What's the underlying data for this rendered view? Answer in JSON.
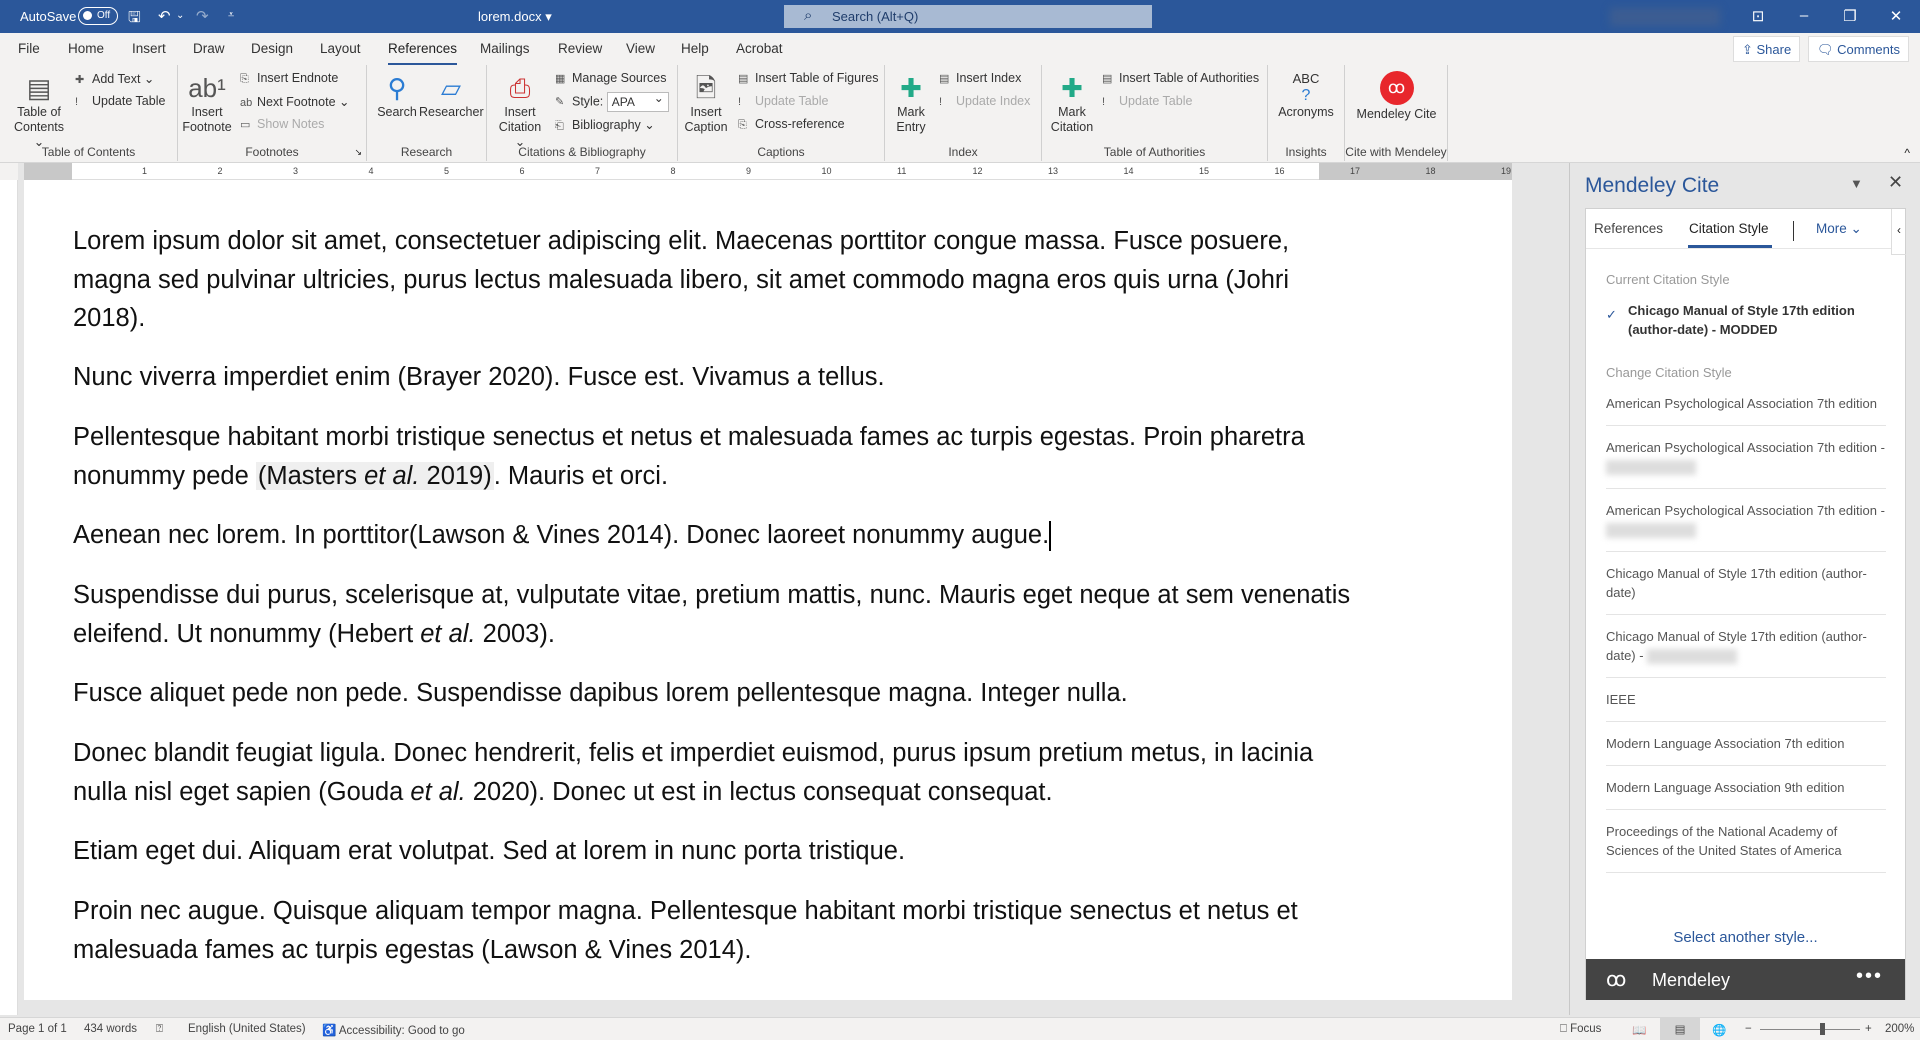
{
  "titlebar": {
    "autosave_label": "AutoSave",
    "autosave_state": "Off",
    "doc_name": "lorem.docx ▾",
    "search_placeholder": "Search (Alt+Q)",
    "icons": [
      "save-icon",
      "undo-icon",
      "redo-icon",
      "customize-icon"
    ]
  },
  "tabs": [
    "File",
    "Home",
    "Insert",
    "Draw",
    "Design",
    "Layout",
    "References",
    "Mailings",
    "Review",
    "View",
    "Help",
    "Acrobat"
  ],
  "active_tab": "References",
  "share_label": "Share",
  "comments_label": "Comments",
  "ribbon": {
    "toc": {
      "label": "Table of Contents",
      "big": "Table of Contents ⌄",
      "add_text": "Add Text ⌄",
      "update_table": "Update Table"
    },
    "footnotes": {
      "label": "Footnotes",
      "big": "Insert Footnote",
      "insert_endnote": "Insert Endnote",
      "next_footnote": "Next Footnote ⌄",
      "show_notes": "Show Notes"
    },
    "research": {
      "label": "Research",
      "search": "Search",
      "researcher": "Researcher"
    },
    "citations": {
      "label": "Citations & Bibliography",
      "big": "Insert Citation ⌄",
      "manage_sources": "Manage Sources",
      "style_label": "Style:",
      "style_value": "APA",
      "bibliography": "Bibliography ⌄"
    },
    "captions": {
      "label": "Captions",
      "big": "Insert Caption",
      "insert_tof": "Insert Table of Figures",
      "update_table": "Update Table",
      "cross_reference": "Cross-reference"
    },
    "index": {
      "label": "Index",
      "big": "Mark Entry",
      "insert_index": "Insert Index",
      "update_index": "Update Index"
    },
    "toa": {
      "label": "Table of Authorities",
      "big": "Mark Citation",
      "insert_toa": "Insert Table of Authorities",
      "update_table": "Update Table"
    },
    "insights": {
      "label": "Insights",
      "big": "Acronyms",
      "icon_text": "ABC"
    },
    "mendeley": {
      "label": "Cite with Mendeley",
      "big": "Mendeley Cite"
    }
  },
  "ruler_numbers": [
    "1",
    "2",
    "3",
    "4",
    "5",
    "6",
    "7",
    "8",
    "9",
    "10",
    "11",
    "12",
    "13",
    "14",
    "15",
    "16",
    "17",
    "18",
    "19"
  ],
  "document": {
    "paragraphs": [
      [
        "Lorem ipsum dolor sit amet, consectetuer adipiscing elit. Maecenas porttitor congue massa. Fusce posuere, magna sed pulvinar ultricies, purus lectus malesuada libero, sit amet commodo magna eros quis urna (Johri 2018)."
      ],
      [
        "Nunc viverra imperdiet enim (Brayer 2020). Fusce est. Vivamus a tellus."
      ],
      [
        "Pellentesque habitant morbi tristique senectus et netus et malesuada fames ac turpis egestas. Proin pharetra nonummy pede ",
        "(Masters ",
        "et al.",
        " 2019)",
        ". Mauris et orci."
      ],
      [
        "Aenean nec lorem. In porttitor(Lawson & Vines 2014). Donec laoreet nonummy augue."
      ],
      [
        "Suspendisse dui purus, scelerisque at, vulputate vitae, pretium mattis, nunc. Mauris eget neque at sem venenatis eleifend. Ut nonummy (Hebert ",
        "et al.",
        " 2003)."
      ],
      [
        "Fusce aliquet pede non pede. Suspendisse dapibus lorem pellentesque magna. Integer nulla."
      ],
      [
        "Donec blandit feugiat ligula. Donec hendrerit, felis et imperdiet euismod, purus ipsum pretium metus, in lacinia nulla nisl eget sapien (Gouda ",
        "et al.",
        " 2020). Donec ut est in lectus consequat consequat."
      ],
      [
        "Etiam eget dui. Aliquam erat volutpat. Sed at lorem in nunc porta tristique."
      ],
      [
        "Proin nec augue. Quisque aliquam tempor magna. Pellentesque habitant morbi tristique senectus et netus et malesuada fames ac turpis egestas (Lawson & Vines 2014)."
      ]
    ]
  },
  "pane": {
    "title": "Mendeley Cite",
    "tabs": [
      "References",
      "Citation Style",
      "More"
    ],
    "active_tab": "Citation Style",
    "current_heading": "Current Citation Style",
    "current_style": "Chicago Manual of Style 17th edition (author-date) - MODDED",
    "change_heading": "Change Citation Style",
    "styles": [
      {
        "text": "American Psychological Association 7th edition",
        "blurred": false
      },
      {
        "text": "American Psychological Association 7th edition - ",
        "blurred": true
      },
      {
        "text": "American Psychological Association 7th edition - ",
        "blurred": true
      },
      {
        "text": "Chicago Manual of Style 17th edition (author-date)",
        "blurred": false
      },
      {
        "text": "Chicago Manual of Style 17th edition (author-date) - ",
        "blurred": true
      },
      {
        "text": "IEEE",
        "blurred": false
      },
      {
        "text": "Modern Language Association 7th edition",
        "blurred": false
      },
      {
        "text": "Modern Language Association 9th edition",
        "blurred": false
      },
      {
        "text": "Proceedings of the National Academy of Sciences of the United States of America",
        "blurred": false
      }
    ],
    "select_another": "Select another style...",
    "footer_brand": "Mendeley",
    "footer_more": "•••"
  },
  "status": {
    "page": "Page 1 of 1",
    "words": "434 words",
    "language": "English (United States)",
    "accessibility": "Accessibility: Good to go",
    "focus": "Focus",
    "zoom": "200%",
    "zoom_percent": 200
  },
  "colors": {
    "word_blue": "#2b579a",
    "mendeley_red": "#e8272c",
    "pane_footer": "#444444"
  }
}
